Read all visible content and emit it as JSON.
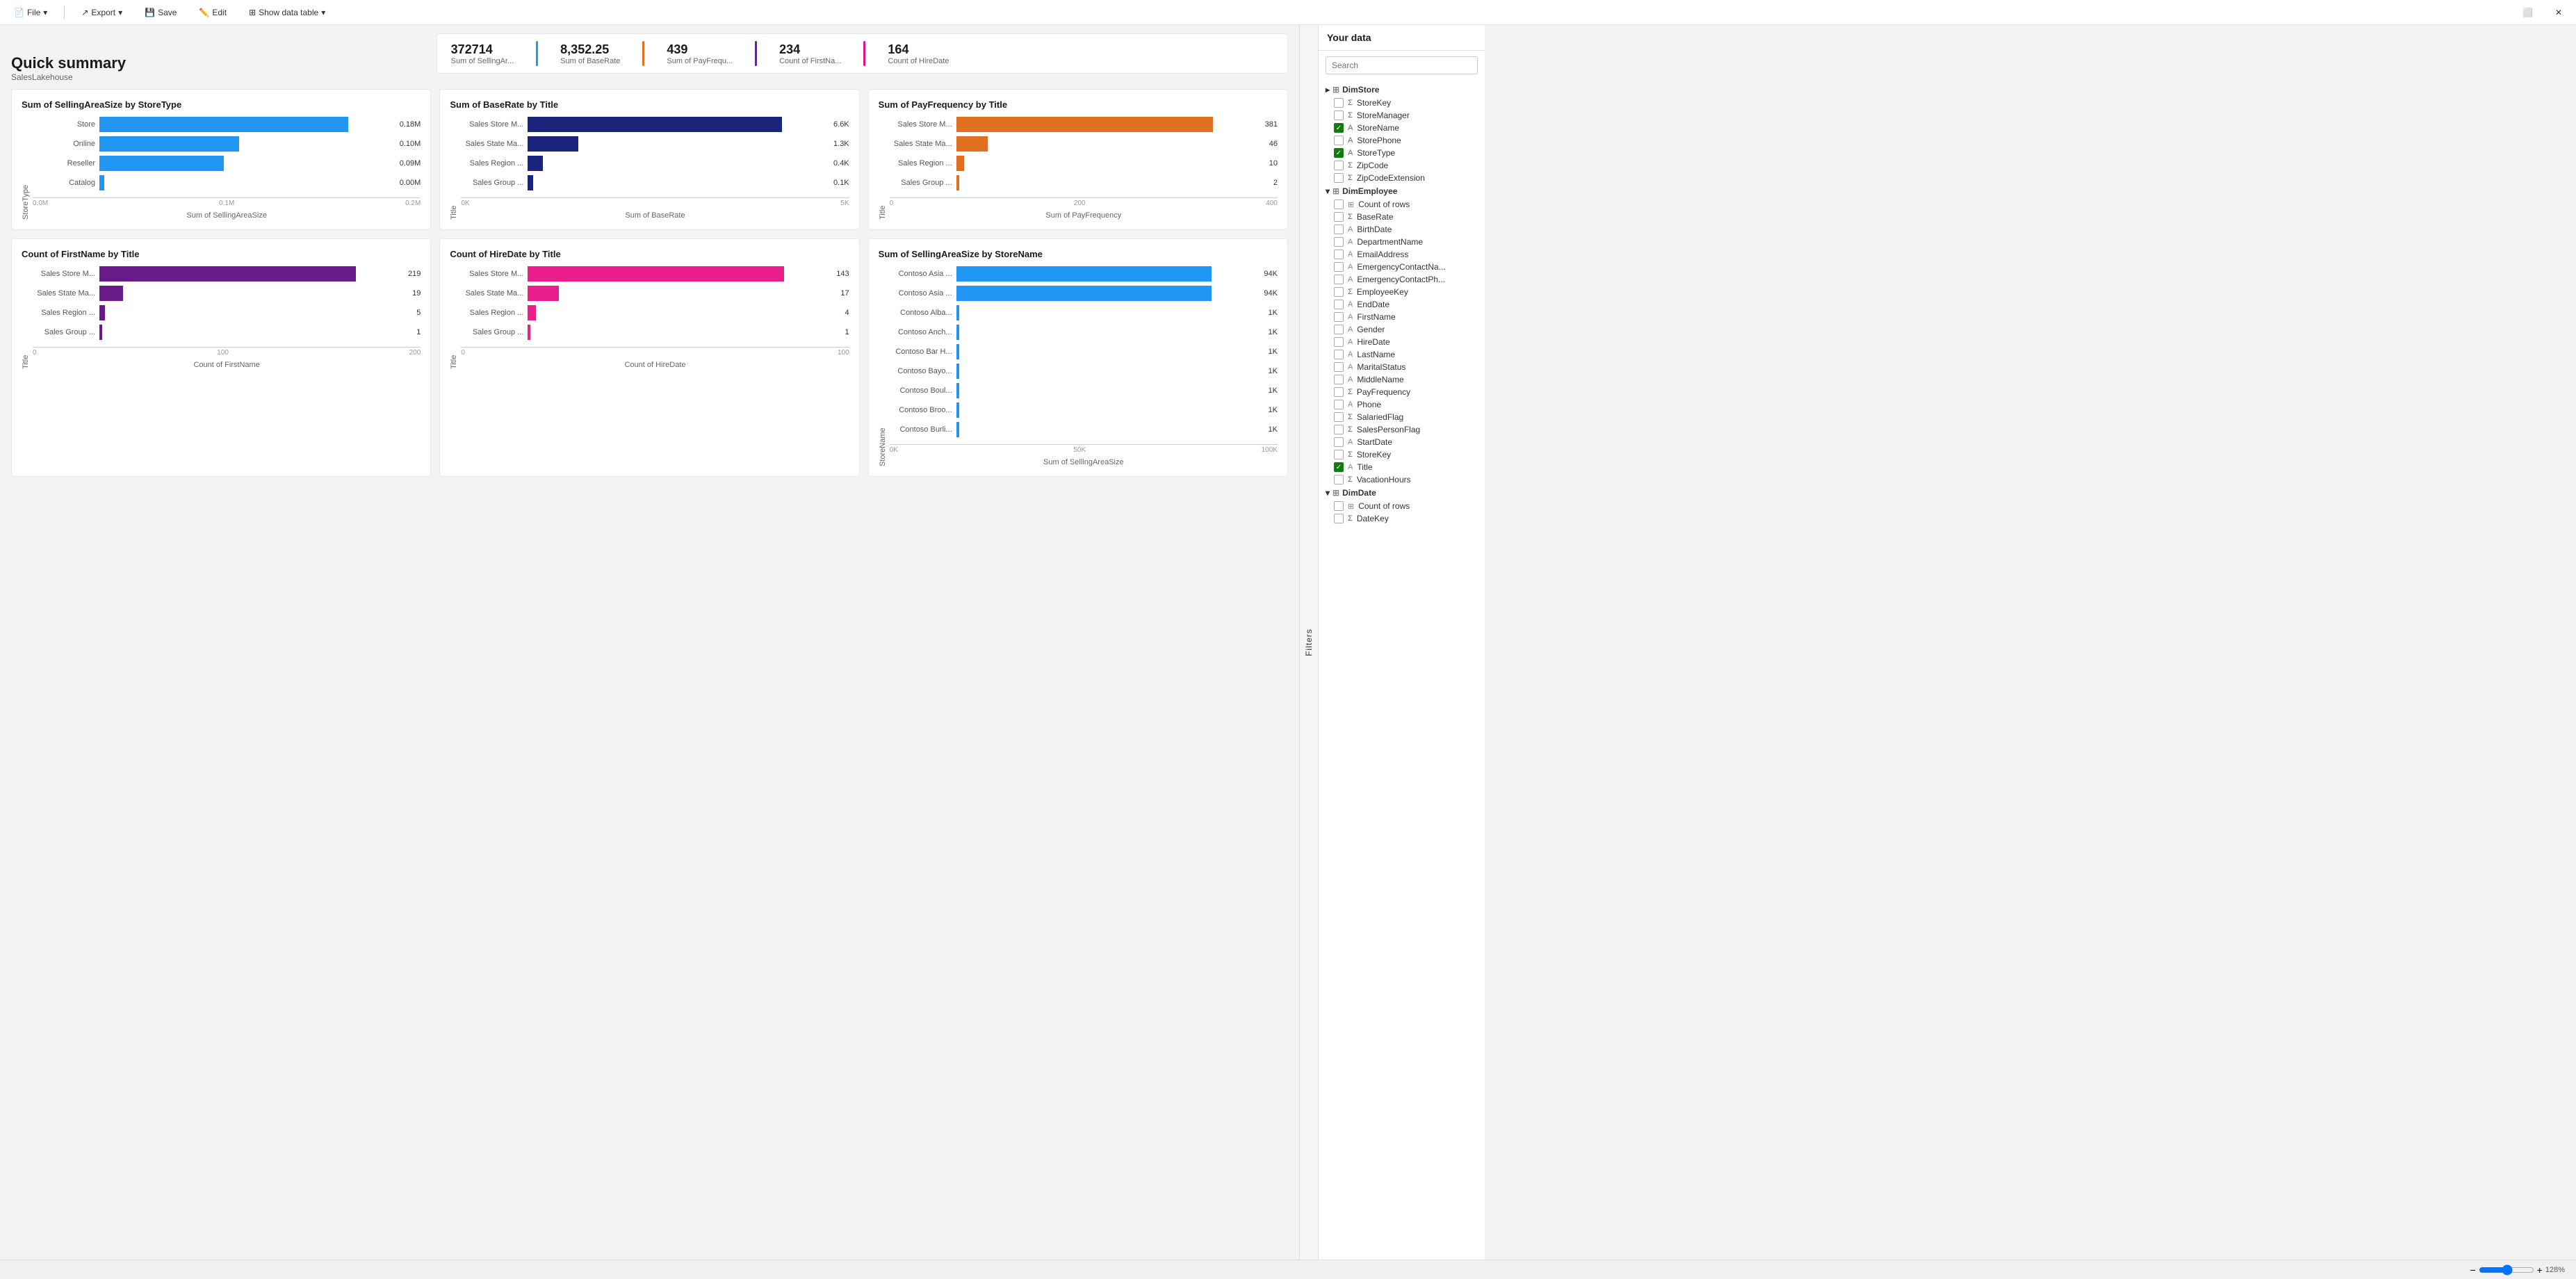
{
  "toolbar": {
    "file_label": "File",
    "export_label": "Export",
    "save_label": "Save",
    "edit_label": "Edit",
    "show_data_table_label": "Show data table"
  },
  "page": {
    "title": "Quick summary",
    "subtitle": "SalesLakehouse"
  },
  "kpi": [
    {
      "value": "372714",
      "label": "Sum of SellingAr...",
      "color": "#2196F3"
    },
    {
      "value": "8,352.25",
      "label": "Sum of BaseRate",
      "color": "#2196F3"
    },
    {
      "value": "439",
      "label": "Sum of PayFrequ...",
      "color": "#E07020"
    },
    {
      "value": "234",
      "label": "Count of FirstNa...",
      "color": "#5B2C8D"
    },
    {
      "value": "164",
      "label": "Count of HireDate",
      "color": "#E01090"
    }
  ],
  "charts": [
    {
      "id": "chart1",
      "title": "Sum of SellingAreaSize by StoreType",
      "y_axis_label": "StoreType",
      "x_axis_label": "Sum of SellingAreaSize",
      "color": "#2196F3",
      "bars": [
        {
          "label": "Store",
          "value": "0.18M",
          "pct": 100
        },
        {
          "label": "Online",
          "value": "0.10M",
          "pct": 56
        },
        {
          "label": "Reseller",
          "value": "0.09M",
          "pct": 50
        },
        {
          "label": "Catalog",
          "value": "0.00M",
          "pct": 2
        }
      ],
      "x_ticks": [
        "0.0M",
        "0.1M",
        "0.2M"
      ]
    },
    {
      "id": "chart2",
      "title": "Sum of BaseRate by Title",
      "y_axis_label": "Title",
      "x_axis_label": "Sum of BaseRate",
      "color": "#1A237E",
      "bars": [
        {
          "label": "Sales Store M...",
          "value": "6.6K",
          "pct": 100
        },
        {
          "label": "Sales State Ma...",
          "value": "1.3K",
          "pct": 20
        },
        {
          "label": "Sales Region ...",
          "value": "0.4K",
          "pct": 6
        },
        {
          "label": "Sales Group ...",
          "value": "0.1K",
          "pct": 2
        }
      ],
      "x_ticks": [
        "0K",
        "5K"
      ]
    },
    {
      "id": "chart3",
      "title": "Sum of PayFrequency by Title",
      "y_axis_label": "Title",
      "x_axis_label": "Sum of PayFrequency",
      "color": "#E07020",
      "bars": [
        {
          "label": "Sales Store M...",
          "value": "381",
          "pct": 100
        },
        {
          "label": "Sales State Ma...",
          "value": "46",
          "pct": 12
        },
        {
          "label": "Sales Region ...",
          "value": "10",
          "pct": 3
        },
        {
          "label": "Sales Group ...",
          "value": "2",
          "pct": 1
        }
      ],
      "x_ticks": [
        "0",
        "200",
        "400"
      ]
    },
    {
      "id": "chart4",
      "title": "Count of FirstName by Title",
      "y_axis_label": "Title",
      "x_axis_label": "Count of FirstName",
      "color": "#6A1B8A",
      "bars": [
        {
          "label": "Sales Store M...",
          "value": "219",
          "pct": 100
        },
        {
          "label": "Sales State Ma...",
          "value": "19",
          "pct": 9
        },
        {
          "label": "Sales Region ...",
          "value": "5",
          "pct": 2
        },
        {
          "label": "Sales Group ...",
          "value": "1",
          "pct": 0.5
        }
      ],
      "x_ticks": [
        "0",
        "100",
        "200"
      ]
    },
    {
      "id": "chart5",
      "title": "Count of HireDate by Title",
      "y_axis_label": "Title",
      "x_axis_label": "Count of HireDate",
      "color": "#E91E8C",
      "bars": [
        {
          "label": "Sales Store M...",
          "value": "143",
          "pct": 100
        },
        {
          "label": "Sales State Ma...",
          "value": "17",
          "pct": 12
        },
        {
          "label": "Sales Region ...",
          "value": "4",
          "pct": 3
        },
        {
          "label": "Sales Group ...",
          "value": "1",
          "pct": 1
        }
      ],
      "x_ticks": [
        "0",
        "100"
      ]
    },
    {
      "id": "chart6",
      "title": "Sum of SellingAreaSize by StoreName",
      "y_axis_label": "StoreName",
      "x_axis_label": "Sum of SellingAreaSize",
      "color": "#2196F3",
      "bars": [
        {
          "label": "Contoso Asia ...",
          "value": "94K",
          "pct": 100
        },
        {
          "label": "Contoso Asia ...",
          "value": "94K",
          "pct": 100
        },
        {
          "label": "Contoso Alba...",
          "value": "1K",
          "pct": 1
        },
        {
          "label": "Contoso Anch...",
          "value": "1K",
          "pct": 1
        },
        {
          "label": "Contoso Bar H...",
          "value": "1K",
          "pct": 1
        },
        {
          "label": "Contoso Bayo...",
          "value": "1K",
          "pct": 1
        },
        {
          "label": "Contoso Boul...",
          "value": "1K",
          "pct": 1
        },
        {
          "label": "Contoso Broo...",
          "value": "1K",
          "pct": 1
        },
        {
          "label": "Contoso Burli...",
          "value": "1K",
          "pct": 1
        }
      ],
      "x_ticks": [
        "0K",
        "50K",
        "100K"
      ]
    }
  ],
  "sidebar": {
    "title": "Your data",
    "search_placeholder": "Search",
    "filters_label": "Filters",
    "groups": [
      {
        "name": "DimStore",
        "icon": "table",
        "expanded": false,
        "items": [
          {
            "label": "StoreKey",
            "type": "sigma",
            "checked": false
          },
          {
            "label": "StoreManager",
            "type": "sigma",
            "checked": false
          },
          {
            "label": "StoreName",
            "type": "text",
            "checked": true
          },
          {
            "label": "StorePhone",
            "type": "text",
            "checked": false
          },
          {
            "label": "StoreType",
            "type": "text",
            "checked": true
          },
          {
            "label": "ZipCode",
            "type": "sigma",
            "checked": false
          },
          {
            "label": "ZipCodeExtension",
            "type": "sigma",
            "checked": false
          }
        ]
      },
      {
        "name": "DimEmployee",
        "icon": "table",
        "expanded": true,
        "items": [
          {
            "label": "Count of rows",
            "type": "table",
            "checked": false
          },
          {
            "label": "BaseRate",
            "type": "sigma",
            "checked": false
          },
          {
            "label": "BirthDate",
            "type": "text",
            "checked": false
          },
          {
            "label": "DepartmentName",
            "type": "text",
            "checked": false
          },
          {
            "label": "EmailAddress",
            "type": "text",
            "checked": false
          },
          {
            "label": "EmergencyContactNa...",
            "type": "text",
            "checked": false
          },
          {
            "label": "EmergencyContactPh...",
            "type": "text",
            "checked": false
          },
          {
            "label": "EmployeeKey",
            "type": "sigma",
            "checked": false
          },
          {
            "label": "EndDate",
            "type": "text",
            "checked": false
          },
          {
            "label": "FirstName",
            "type": "text",
            "checked": false
          },
          {
            "label": "Gender",
            "type": "text",
            "checked": false
          },
          {
            "label": "HireDate",
            "type": "text",
            "checked": false
          },
          {
            "label": "LastName",
            "type": "text",
            "checked": false
          },
          {
            "label": "MaritalStatus",
            "type": "text",
            "checked": false
          },
          {
            "label": "MiddleName",
            "type": "text",
            "checked": false
          },
          {
            "label": "PayFrequency",
            "type": "sigma",
            "checked": false
          },
          {
            "label": "Phone",
            "type": "text",
            "checked": false
          },
          {
            "label": "SalariedFlag",
            "type": "sigma",
            "checked": false
          },
          {
            "label": "SalesPersonFlag",
            "type": "sigma",
            "checked": false
          },
          {
            "label": "StartDate",
            "type": "text",
            "checked": false
          },
          {
            "label": "StoreKey",
            "type": "sigma",
            "checked": false
          },
          {
            "label": "Title",
            "type": "text",
            "checked": true
          },
          {
            "label": "VacationHours",
            "type": "sigma",
            "checked": false
          }
        ]
      },
      {
        "name": "DimDate",
        "icon": "table",
        "expanded": true,
        "items": [
          {
            "label": "Count of rows",
            "type": "table",
            "checked": false
          },
          {
            "label": "DateKey",
            "type": "sigma",
            "checked": false
          }
        ]
      }
    ]
  },
  "bottom_bar": {
    "zoom": "128%"
  }
}
